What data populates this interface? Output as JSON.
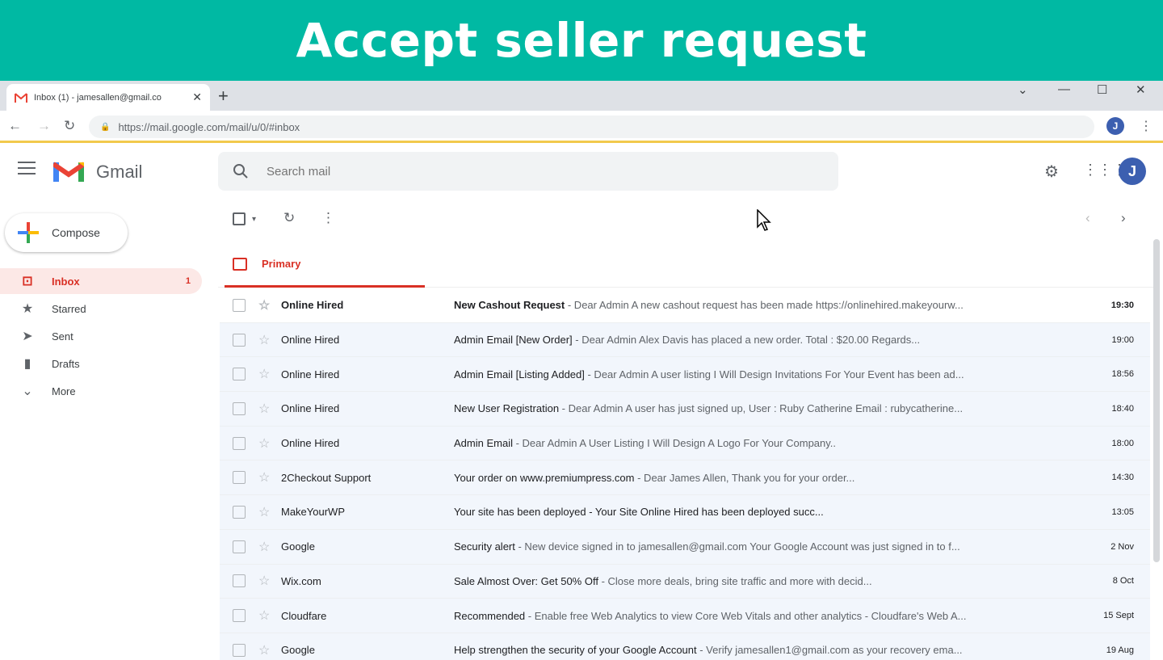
{
  "banner": {
    "title": "Accept seller request"
  },
  "browser": {
    "tab_title": "Inbox (1) - jamesallen@gmail.co",
    "url": "https://mail.google.com/mail/u/0/#inbox",
    "profile_initial": "J"
  },
  "gmail": {
    "brand": "Gmail",
    "search_placeholder": "Search mail",
    "avatar_initial": "J",
    "compose_label": "Compose",
    "primary_tab": "Primary",
    "nav": [
      {
        "label": "Inbox",
        "count": "1",
        "icon": "inbox-icon"
      },
      {
        "label": "Starred",
        "count": "",
        "icon": "star-icon"
      },
      {
        "label": "Sent",
        "count": "",
        "icon": "send-icon"
      },
      {
        "label": "Drafts",
        "count": "",
        "icon": "draft-icon"
      },
      {
        "label": "More",
        "count": "",
        "icon": "chevron-down-icon"
      }
    ],
    "emails": [
      {
        "sender": "Online Hired",
        "subject": "New Cashout Request",
        "snippet": " - Dear Admin A new cashout request has been made https://onlinehired.makeyourw...",
        "date": "19:30",
        "unread": true
      },
      {
        "sender": "Online Hired",
        "subject": "Admin Email [New Order]",
        "snippet": " - Dear Admin Alex Davis has placed a new order. Total : $20.00 Regards...",
        "date": "19:00",
        "unread": false
      },
      {
        "sender": "Online Hired",
        "subject": "Admin Email [Listing Added]",
        "snippet": " - Dear Admin A user listing I Will Design Invitations For Your Event has been ad...",
        "date": "18:56",
        "unread": false
      },
      {
        "sender": "Online Hired",
        "subject": "New User Registration",
        "snippet": " - Dear Admin A user has just signed up, User : Ruby Catherine Email : rubycatherine...",
        "date": "18:40",
        "unread": false
      },
      {
        "sender": "Online Hired",
        "subject": "Admin Email",
        "snippet": " - Dear Admin A User Listing I Will Design A Logo For Your Company..",
        "date": "18:00",
        "unread": false
      },
      {
        "sender": "2Checkout Support",
        "subject": "Your order on www.premiumpress.com",
        "snippet": " - Dear James Allen, Thank you for your order...",
        "date": "14:30",
        "unread": false
      },
      {
        "sender": "MakeYourWP",
        "subject": "Your site has been deployed - Your Site Online Hired has been deployed succ...",
        "snippet": "",
        "date": "13:05",
        "unread": false
      },
      {
        "sender": "Google",
        "subject": "Security alert",
        "snippet": " - New device signed in to jamesallen@gmail.com Your Google Account was just signed in to f...",
        "date": "2 Nov",
        "unread": false
      },
      {
        "sender": "Wix.com",
        "subject": "Sale Almost Over: Get 50% Off",
        "snippet": " - Close more deals, bring site traffic and more with decid...",
        "date": "8 Oct",
        "unread": false
      },
      {
        "sender": "Cloudfare",
        "subject": "Recommended",
        "snippet": " - Enable free Web Analytics to view Core Web Vitals and other analytics - Cloudfare's Web A...",
        "date": "15 Sept",
        "unread": false
      },
      {
        "sender": "Google",
        "subject": "Help strengthen the security of your Google Account",
        "snippet": " - Verify jamesallen1@gmail.com as your recovery ema...",
        "date": "19 Aug",
        "unread": false
      }
    ]
  },
  "colors": {
    "banner": "#00b9a3",
    "accent": "#d93025",
    "avatar": "#3c5fb0"
  }
}
